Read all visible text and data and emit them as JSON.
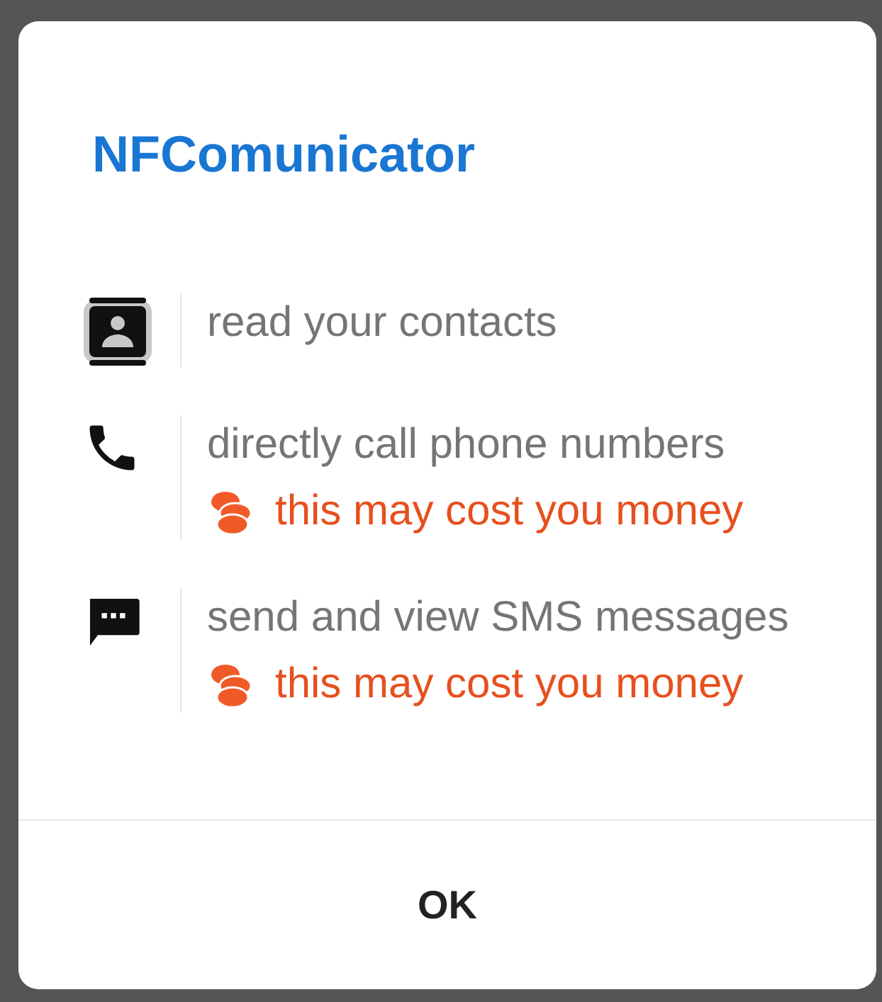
{
  "dialog": {
    "title": "NFComunicator",
    "permissions": [
      {
        "kind": "contacts",
        "label": "read your contacts"
      },
      {
        "kind": "phone",
        "label": "directly call phone numbers",
        "warning": "this may cost you money"
      },
      {
        "kind": "sms",
        "label": "send and view SMS messages",
        "warning": "this may cost you money"
      }
    ],
    "buttons": [
      "OK"
    ]
  }
}
